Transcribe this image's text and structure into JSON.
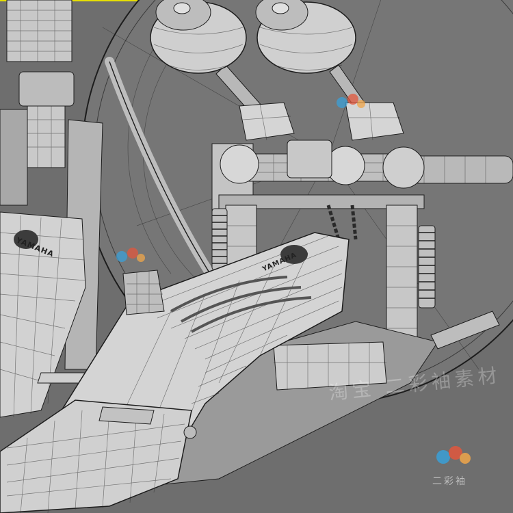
{
  "scene": {
    "colors": {
      "background": "#6e6e6e",
      "model_light": "#d9d9d9",
      "model_mid": "#b4b4b4",
      "model_dark": "#8a8a8a",
      "wire": "#2a2a2a",
      "top_edge": "#e8e000"
    }
  },
  "logos": {
    "brand_left": "YAMAHA",
    "brand_right": "YAMAHA"
  },
  "watermarks": {
    "bottom_text": "淘宝 二彩袖素材",
    "brand_text": "二彩袖",
    "icon_name": "three-dots-logo-icon"
  }
}
